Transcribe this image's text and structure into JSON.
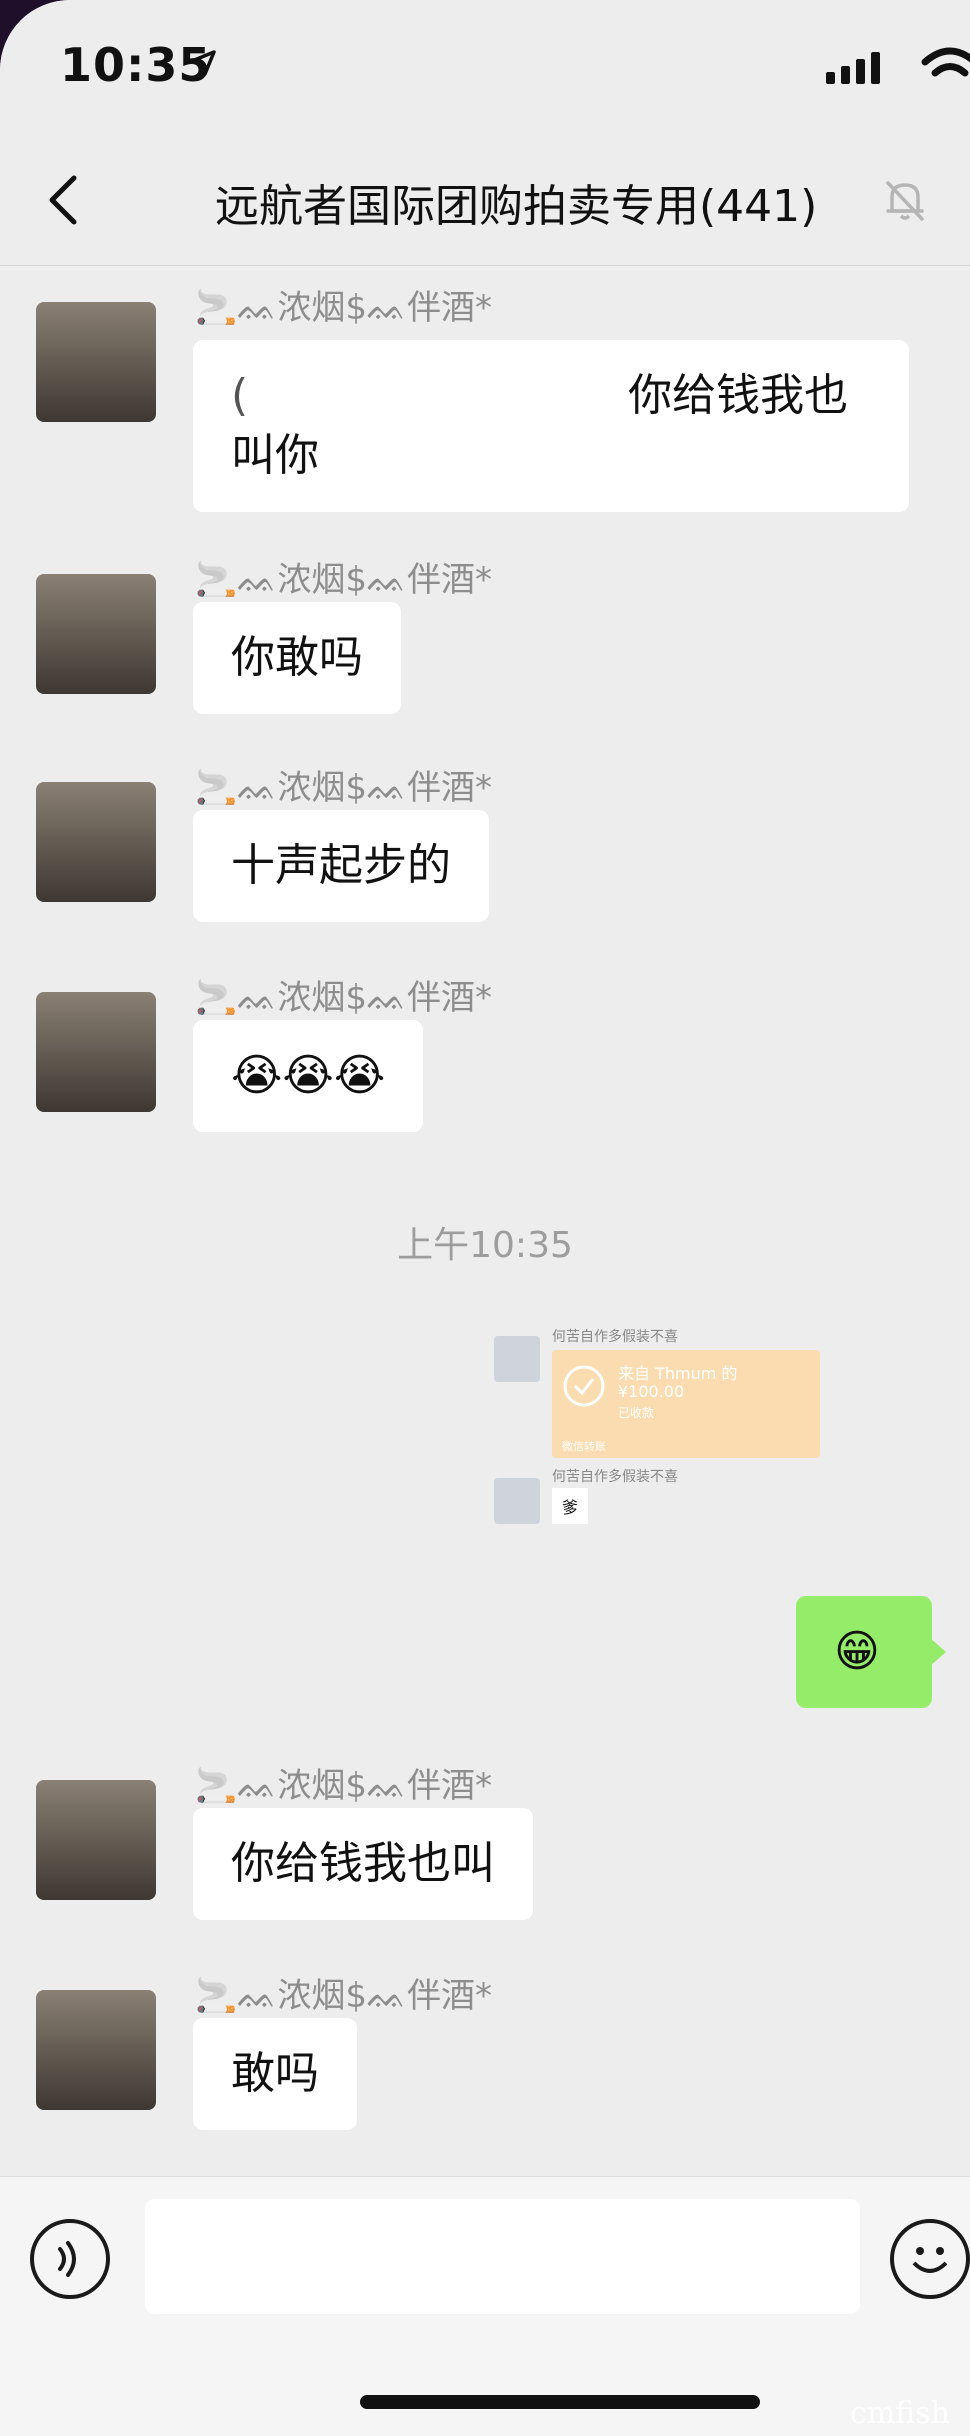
{
  "status_bar": {
    "time": "10:35"
  },
  "header": {
    "title": "远航者国际团购拍卖专用(441)"
  },
  "messages": [
    {
      "sender": "🚬ᨐ浓烟$ᨐ伴酒*",
      "text": "你给钱我也叫你",
      "prefix": "("
    },
    {
      "sender": "🚬ᨐ浓烟$ᨐ伴酒*",
      "text": "你敢吗"
    },
    {
      "sender": "🚬ᨐ浓烟$ᨐ伴酒*",
      "text": "十声起步的"
    },
    {
      "sender": "🚬ᨐ浓烟$ᨐ伴酒*",
      "text": "😭😭😭"
    },
    {
      "sender": "🚬ᨐ浓烟$ᨐ伴酒*",
      "text": "你给钱我也叫"
    },
    {
      "sender": "🚬ᨐ浓烟$ᨐ伴酒*",
      "text": "敢吗"
    }
  ],
  "timestamp": "上午10:35",
  "embedded_screenshot": {
    "sender1": "何苦自作多假装不喜",
    "transfer_title": "来自 Thmum 的",
    "transfer_amount": "¥100.00",
    "transfer_status": "已收款",
    "transfer_footer": "微信转账",
    "sender2": "何苦自作多假装不喜",
    "reply": "爹"
  },
  "my_message": "😁",
  "input": {
    "placeholder": ""
  },
  "watermark": "cmfish"
}
